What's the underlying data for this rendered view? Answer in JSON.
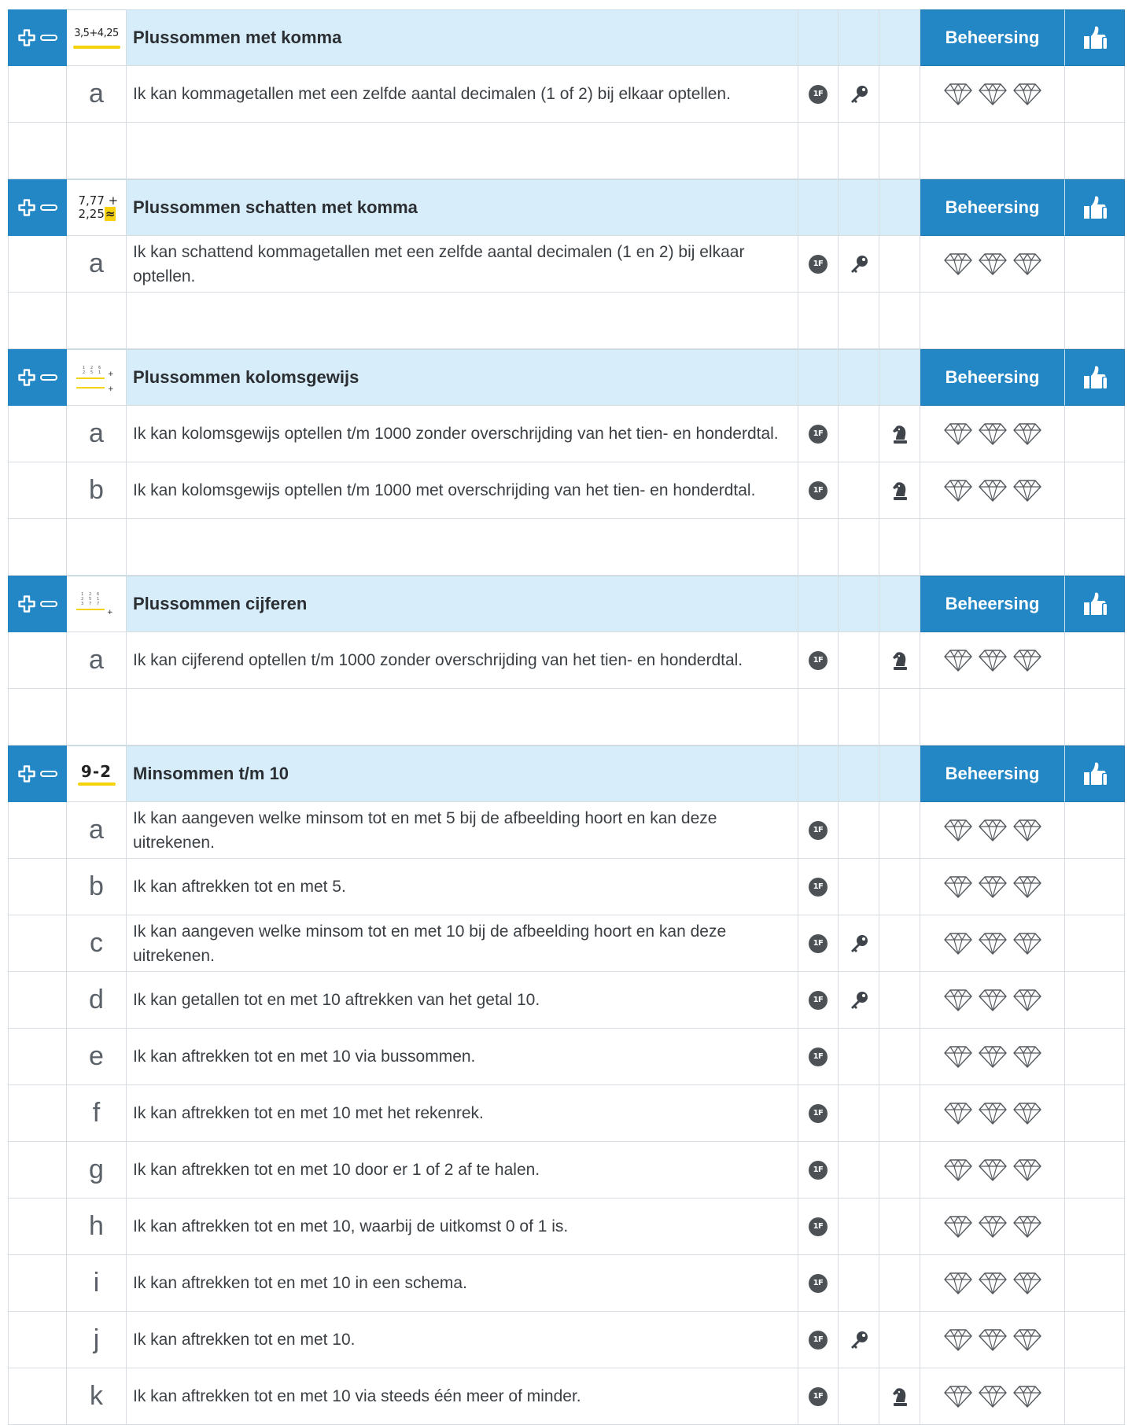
{
  "mastery_label": "Beheersing",
  "level_badge": "1F",
  "icons": {
    "plus": "plus-icon",
    "minus": "minus-icon",
    "thumbs_up": "thumbs-up-icon",
    "key": "key-icon",
    "chess_knight": "chess-knight-icon",
    "diamond": "diamond-icon",
    "level_badge": "level-1f-badge"
  },
  "colors": {
    "header_blue": "#2387c6",
    "header_light": "#d7edf9",
    "accent_yellow": "#f5d20c",
    "badge_gray": "#4d5156"
  },
  "sections": [
    {
      "title": "Plussommen met komma",
      "thumbnail": {
        "kind": "sum",
        "lines": [
          "3,5+4,25"
        ]
      },
      "goals": [
        {
          "letter": "a",
          "text": "Ik kan kommagetallen met een zelfde aantal decimalen (1 of 2) bij elkaar optellen.",
          "level": true,
          "key": true,
          "knight": false
        }
      ]
    },
    {
      "title": "Plussommen schatten met komma",
      "thumbnail": {
        "kind": "estimate",
        "lines": [
          "7,77 +",
          "2,25",
          "≈"
        ]
      },
      "goals": [
        {
          "letter": "a",
          "text": "Ik kan schattend kommagetallen met een zelfde aantal decimalen (1 en 2) bij elkaar optellen.",
          "level": true,
          "key": true,
          "knight": false
        }
      ]
    },
    {
      "title": "Plussommen kolomsgewijs",
      "thumbnail": {
        "kind": "columns",
        "lines": []
      },
      "goals": [
        {
          "letter": "a",
          "text": "Ik kan kolomsgewijs optellen t/m 1000 zonder overschrijding van het tien- en honderdtal.",
          "level": true,
          "key": false,
          "knight": true
        },
        {
          "letter": "b",
          "text": "Ik kan kolomsgewijs optellen t/m 1000 met overschrijding van het tien- en honderdtal.",
          "level": true,
          "key": false,
          "knight": true
        }
      ]
    },
    {
      "title": "Plussommen cijferen",
      "thumbnail": {
        "kind": "cipher",
        "lines": []
      },
      "goals": [
        {
          "letter": "a",
          "text": "Ik kan cijferend optellen t/m 1000 zonder overschrijding van het tien- en honderdtal.",
          "level": true,
          "key": false,
          "knight": true
        }
      ]
    },
    {
      "title": "Minsommen t/m 10",
      "thumbnail": {
        "kind": "sum-big",
        "lines": [
          "9-2"
        ]
      },
      "goals": [
        {
          "letter": "a",
          "text": "Ik kan aangeven welke minsom tot en met 5 bij de afbeelding hoort en kan deze uitrekenen.",
          "level": true,
          "key": false,
          "knight": false
        },
        {
          "letter": "b",
          "text": "Ik kan aftrekken tot en met 5.",
          "level": true,
          "key": false,
          "knight": false
        },
        {
          "letter": "c",
          "text": "Ik kan aangeven welke minsom tot en met 10 bij de afbeelding hoort en kan deze uitrekenen.",
          "level": true,
          "key": true,
          "knight": false
        },
        {
          "letter": "d",
          "text": "Ik kan getallen tot en met 10 aftrekken van het getal 10.",
          "level": true,
          "key": true,
          "knight": false
        },
        {
          "letter": "e",
          "text": "Ik kan aftrekken tot en met 10 via bussommen.",
          "level": true,
          "key": false,
          "knight": false
        },
        {
          "letter": "f",
          "text": "Ik kan aftrekken tot en met 10 met het rekenrek.",
          "level": true,
          "key": false,
          "knight": false
        },
        {
          "letter": "g",
          "text": "Ik kan aftrekken tot en met 10 door er 1 of 2 af te halen.",
          "level": true,
          "key": false,
          "knight": false
        },
        {
          "letter": "h",
          "text": "Ik kan aftrekken tot en met 10, waarbij de uitkomst 0 of 1 is.",
          "level": true,
          "key": false,
          "knight": false
        },
        {
          "letter": "i",
          "text": "Ik kan aftrekken tot en met 10 in een schema.",
          "level": true,
          "key": false,
          "knight": false
        },
        {
          "letter": "j",
          "text": "Ik kan aftrekken tot en met 10.",
          "level": true,
          "key": true,
          "knight": false
        },
        {
          "letter": "k",
          "text": "Ik kan aftrekken tot en met 10 via steeds één meer of minder.",
          "level": true,
          "key": false,
          "knight": true
        }
      ]
    }
  ]
}
